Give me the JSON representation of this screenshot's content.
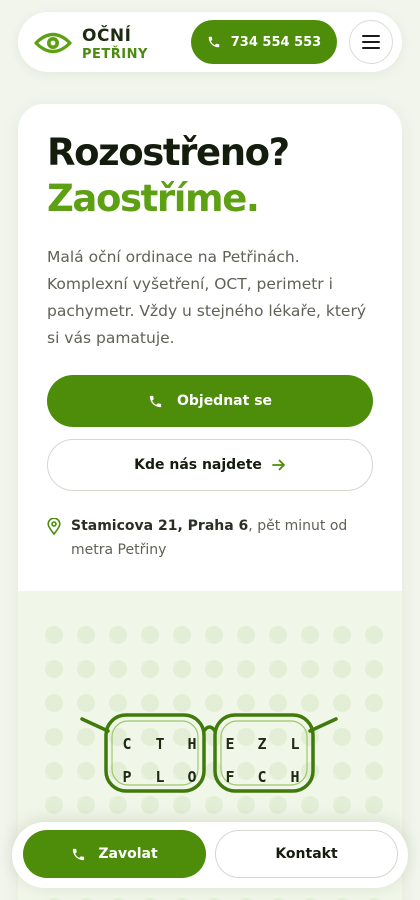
{
  "header": {
    "logo_line1": "OČNÍ",
    "logo_line2": "PETŘINY",
    "phone_label": "734 554 553",
    "menu_icon": "hamburger-icon"
  },
  "hero": {
    "headline_line1": "Rozostřeno?",
    "headline_line2": "Zaostříme.",
    "lead": "Malá oční ordinace na Petřinách. Komplexní vyšetření, OCT, perimetr i pachymetr. Vždy u stejného lékaře, který si vás pamatuje.",
    "primary_button": "Objednat se",
    "secondary_button": "Kde nás najdete",
    "address_bold": "Stamicova 21, Praha 6",
    "address_rest": ", pět minut od metra Petřiny"
  },
  "illustration": {
    "left_lens_row1": [
      "C",
      "T",
      "H"
    ],
    "right_lens_row1": [
      "E",
      "Z",
      "L"
    ],
    "left_lens_row2": [
      "P",
      "L",
      "O"
    ],
    "right_lens_row2": [
      "F",
      "C",
      "H"
    ]
  },
  "bottom_bar": {
    "call_label": "Zavolat",
    "contact_label": "Kontakt"
  },
  "colors": {
    "brand_green": "#4d8d0a",
    "headline_green": "#5ea014",
    "dark_text": "#141c0d"
  }
}
